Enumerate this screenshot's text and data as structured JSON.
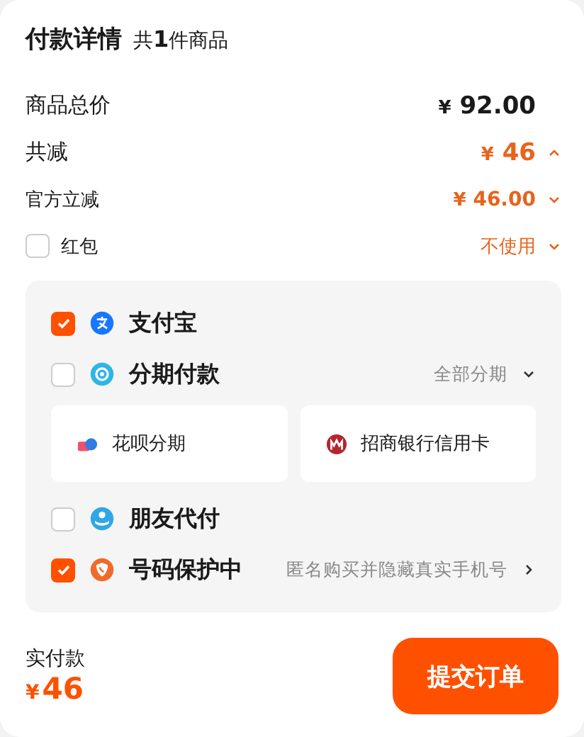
{
  "header": {
    "title": "付款详情",
    "count": "共**1**件商品"
  },
  "summary": [
    {
      "kind": "total",
      "label": "商品总价",
      "currency": "¥",
      "amount": "92.00"
    },
    {
      "kind": "discount",
      "label": "共减",
      "currency": "¥",
      "amount": "46",
      "expanded": true
    },
    {
      "kind": "subdiscount",
      "label": "官方立减",
      "currency": "¥",
      "amount": "46.00",
      "expanded": false
    },
    {
      "kind": "checkbox",
      "label": "红包",
      "checked": false,
      "value": "不使用",
      "expanded": false
    }
  ],
  "payments": [
    {
      "kind": "alipay",
      "name": "支付宝",
      "checked": true
    },
    {
      "kind": "installment",
      "name": "分期付款",
      "checked": false,
      "action": "全部分期",
      "expanded": false,
      "options": [
        {
          "kind": "huabei",
          "name": "花呗分期"
        },
        {
          "kind": "bank",
          "name": "招商银行信用卡"
        }
      ]
    },
    {
      "kind": "friend",
      "name": "朋友代付",
      "checked": false
    },
    {
      "kind": "protection",
      "name": "号码保护中",
      "checked": true,
      "action": "匿名购买并隐藏真实手机号"
    }
  ],
  "footer": {
    "label": "实付款",
    "currency": "¥",
    "amount": "46",
    "button": "提交订单"
  }
}
